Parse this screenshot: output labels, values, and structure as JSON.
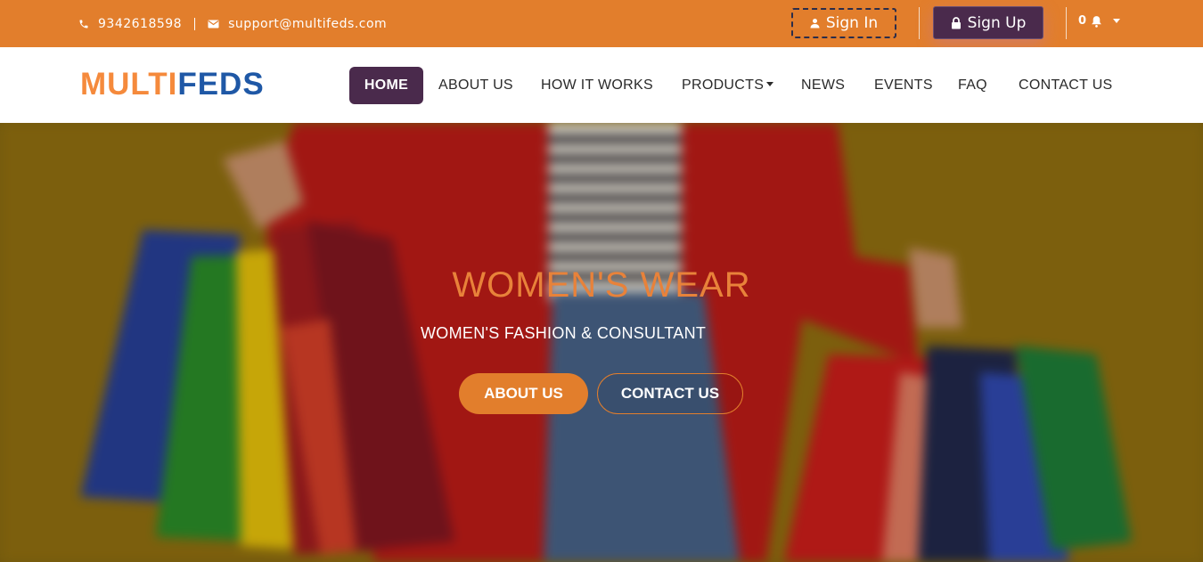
{
  "topbar": {
    "phone": "9342618598",
    "email": "support@multifeds.com",
    "sign_in": "Sign In",
    "sign_up": "Sign Up",
    "notifications_count": "0"
  },
  "brand": {
    "part1": "MULTI",
    "part2": "FEDS"
  },
  "nav": {
    "home": "HOME",
    "about": "ABOUT US",
    "how": "HOW IT WORKS",
    "products": "PRODUCTS",
    "news": "NEWS",
    "events": "EVENTS",
    "faq": "FAQ",
    "contact": "CONTACT US"
  },
  "hero": {
    "title": "WOMEN'S WEAR",
    "subtitle": "WOMEN'S FASHION & CONSULTANT",
    "about_btn": "ABOUT US",
    "contact_btn": "CONTACT US"
  },
  "colors": {
    "topbar": "#e27e2c",
    "accent_purple": "#4a2a4c",
    "brand_orange": "#f58a3c",
    "brand_blue": "#1f58a6"
  }
}
